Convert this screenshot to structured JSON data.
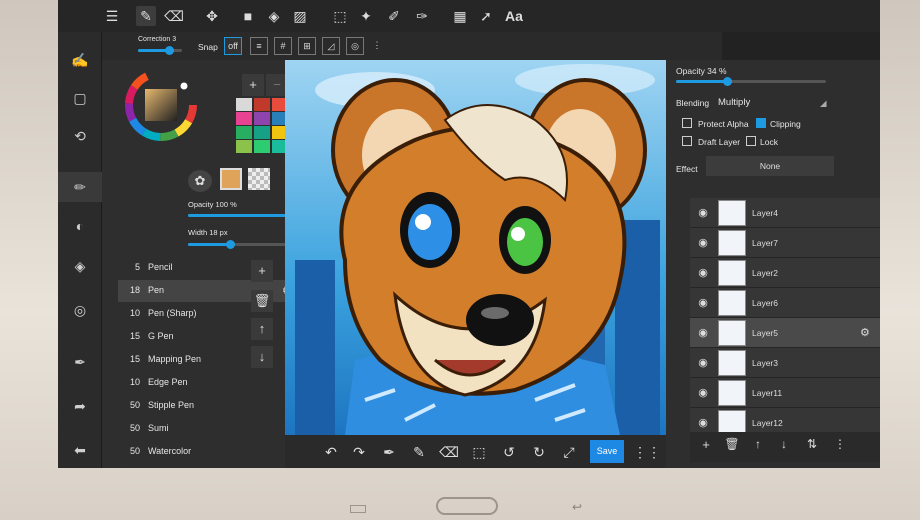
{
  "top_toolbar": {
    "font_label": "Aa"
  },
  "sub_toolbar": {
    "correction_label": "Correction 3",
    "snap_label": "Snap",
    "snap_off_label": "off"
  },
  "color_panel": {
    "swatches": [
      "#d9d9d9",
      "#c0392b",
      "#e74c3c",
      "#e84393",
      "#8e44ad",
      "#2980b9",
      "#27ae60",
      "#16a085",
      "#f1c40f",
      "#8bc34a",
      "#2ecc71",
      "#1abc9c"
    ],
    "current_color": "#e0a35a"
  },
  "brush_panel": {
    "opacity_label": "Opacity 100 %",
    "opacity_value": 1.0,
    "width_label": "Width 18 px",
    "width_value": 0.3,
    "brushes": [
      {
        "size": "5",
        "name": "Pencil"
      },
      {
        "size": "18",
        "name": "Pen"
      },
      {
        "size": "10",
        "name": "Pen (Sharp)"
      },
      {
        "size": "15",
        "name": "G Pen"
      },
      {
        "size": "15",
        "name": "Mapping Pen"
      },
      {
        "size": "10",
        "name": "Edge Pen"
      },
      {
        "size": "50",
        "name": "Stipple Pen"
      },
      {
        "size": "50",
        "name": "Sumi"
      },
      {
        "size": "50",
        "name": "Watercolor"
      }
    ]
  },
  "layer_panel": {
    "opacity_label": "Opacity 34 %",
    "opacity_value": 0.34,
    "blending_label": "Blending",
    "blending_value": "Multiply",
    "protect_alpha_label": "Protect Alpha",
    "clipping_label": "Clipping",
    "draft_layer_label": "Draft Layer",
    "lock_label": "Lock",
    "effect_label": "Effect",
    "effect_value": "None",
    "layers": [
      {
        "name": "Layer4"
      },
      {
        "name": "Layer7"
      },
      {
        "name": "Layer2"
      },
      {
        "name": "Layer6"
      },
      {
        "name": "Layer5"
      },
      {
        "name": "Layer3"
      },
      {
        "name": "Layer11"
      },
      {
        "name": "Layer12"
      }
    ]
  },
  "bottom_toolbar": {
    "save_label": "Save"
  }
}
